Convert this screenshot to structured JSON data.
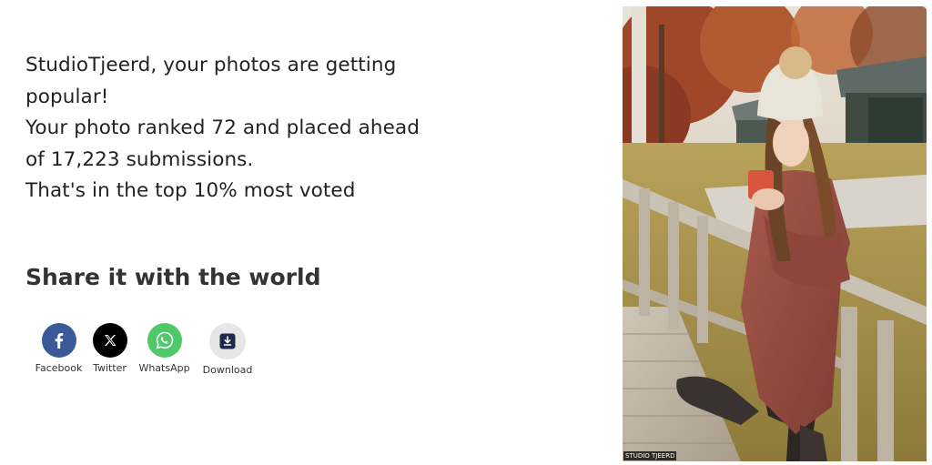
{
  "message": {
    "lines": [
      "StudioTjeerd, your photos are getting",
      "popular!",
      "Your photo ranked 72 and placed ahead",
      "of 17,223 submissions.",
      "That's in the top 10% most voted"
    ]
  },
  "share": {
    "heading": "Share it with the world",
    "items": [
      {
        "label": "Facebook",
        "icon": "facebook-icon",
        "color": "#3b5998"
      },
      {
        "label": "Twitter",
        "icon": "x-icon",
        "color": "#000000"
      },
      {
        "label": "WhatsApp",
        "icon": "whatsapp-icon",
        "color": "#4fc86a"
      },
      {
        "label": "Download",
        "icon": "download-icon",
        "color": "#e6e6e6"
      }
    ]
  },
  "photo": {
    "watermark": "STUDIO TJEERD"
  }
}
